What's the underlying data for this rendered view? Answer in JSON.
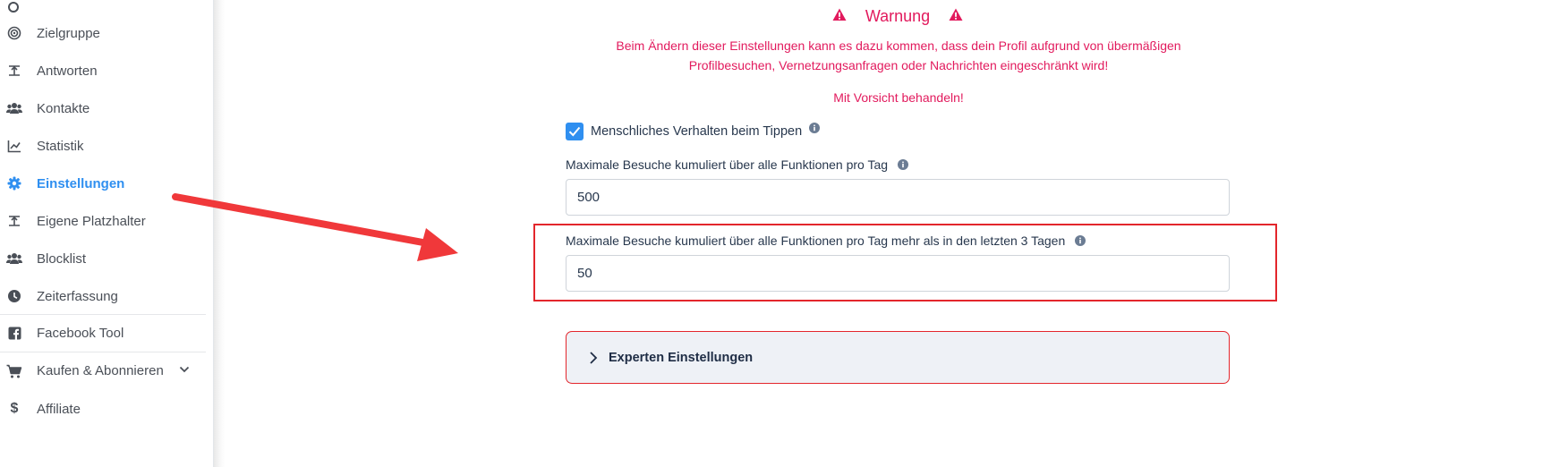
{
  "sidebar": {
    "items": [
      {
        "label": "Zielgruppe",
        "icon": "target-icon"
      },
      {
        "label": "Antworten",
        "icon": "reply-icon"
      },
      {
        "label": "Kontakte",
        "icon": "users-icon"
      },
      {
        "label": "Statistik",
        "icon": "chart-line-icon"
      },
      {
        "label": "Einstellungen",
        "icon": "gear-icon"
      },
      {
        "label": "Eigene Platzhalter",
        "icon": "placeholder-icon"
      },
      {
        "label": "Blocklist",
        "icon": "users-block-icon"
      },
      {
        "label": "Zeiterfassung",
        "icon": "clock-icon"
      },
      {
        "label": "Facebook Tool",
        "icon": "facebook-icon"
      },
      {
        "label": "Kaufen & Abonnieren",
        "icon": "cart-icon"
      },
      {
        "label": "Affiliate",
        "icon": "dollar-icon"
      }
    ]
  },
  "warning": {
    "title": "Warnung",
    "text": "Beim Ändern dieser Einstellungen kann es dazu kommen, dass dein Profil aufgrund von übermäßigen Profilbesuchen, Vernetzungsanfragen oder Nachrichten eingeschränkt wird!",
    "caution": "Mit Vorsicht behandeln!"
  },
  "settings": {
    "human_typing": {
      "label": "Menschliches Verhalten beim Tippen",
      "checked": true
    },
    "max_visits": {
      "label": "Maximale Besuche kumuliert über alle Funktionen pro Tag",
      "value": "500"
    },
    "max_visits_extra": {
      "label": "Maximale Besuche kumuliert über alle Funktionen pro Tag mehr als in den letzten 3 Tagen",
      "value": "50"
    },
    "expert": {
      "label": "Experten Einstellungen"
    }
  },
  "colors": {
    "accent": "#2f8ff0",
    "warning": "#e21a5d",
    "annotation": "#e3262c"
  }
}
